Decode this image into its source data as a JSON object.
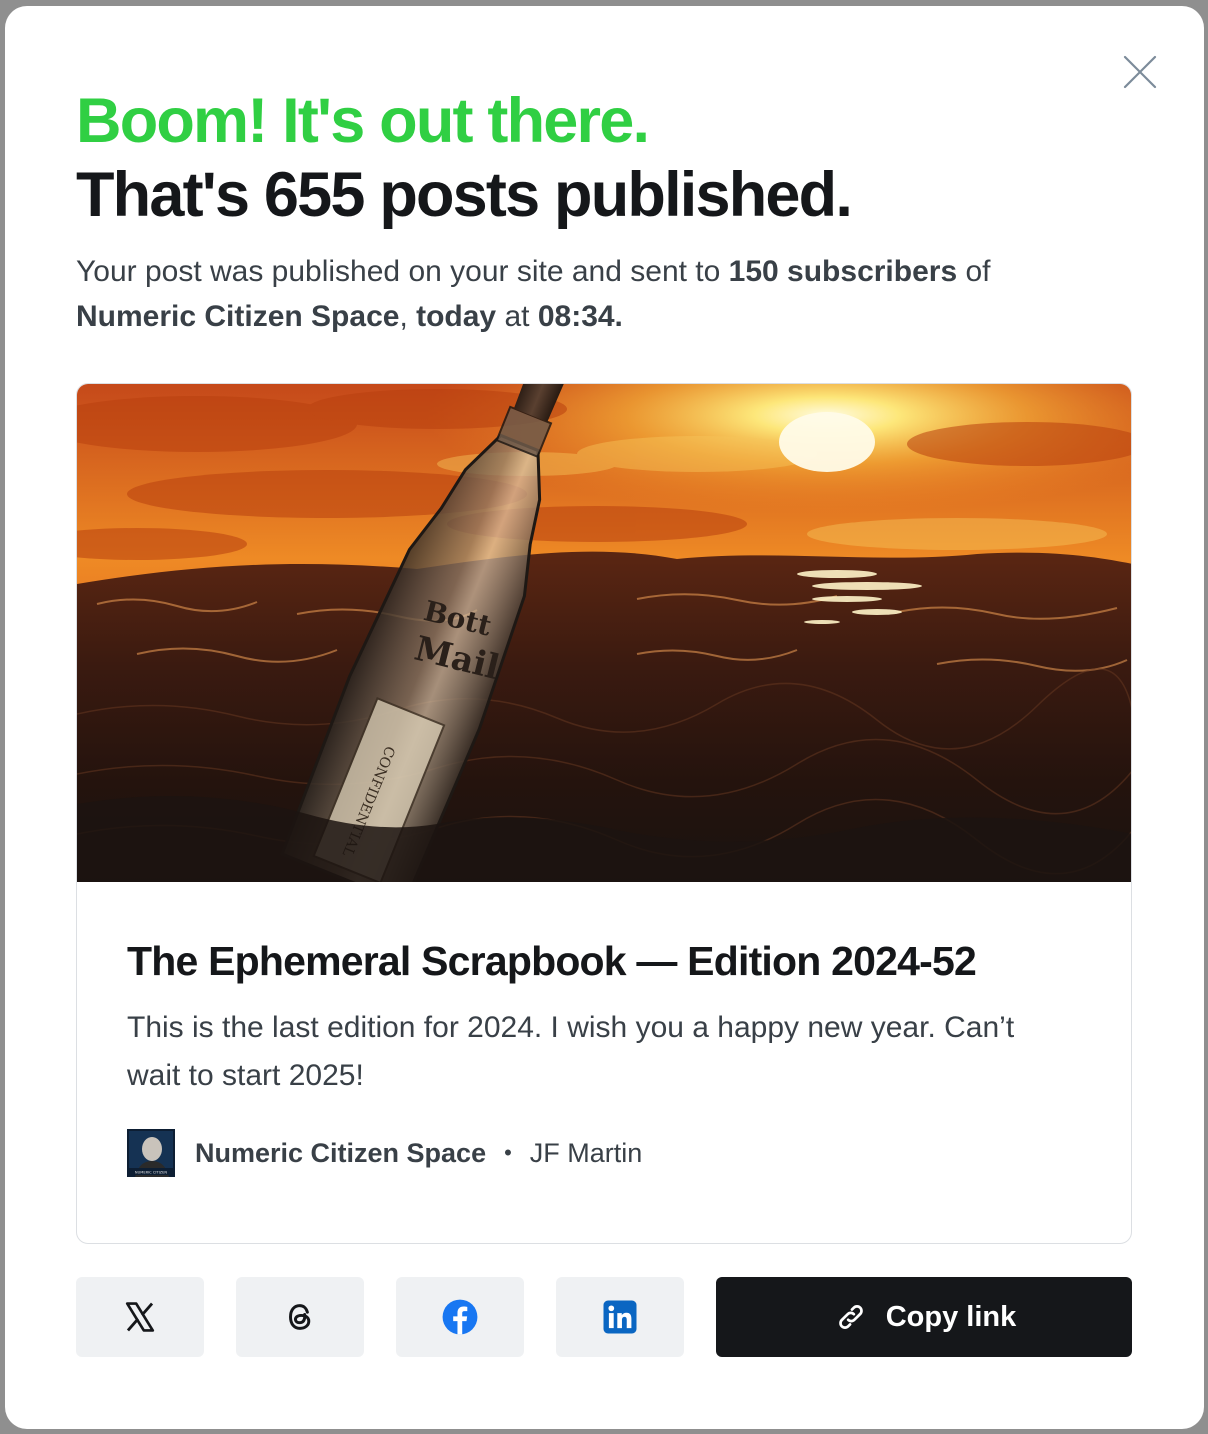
{
  "dialog": {
    "close_icon": "close-icon",
    "headline_success": "Boom! It's out there.",
    "headline_count": "That's 655 posts published.",
    "summary": {
      "prefix": "Your post was published on your site and sent to ",
      "subscribers": "150 subscribers",
      "of": " of",
      "site": "Numeric Citizen Space",
      "comma": ", ",
      "day": "today",
      "at": " at ",
      "time": "08:34."
    }
  },
  "post_card": {
    "image_description_icon": "message-in-bottle-at-sunset-image",
    "bottle_text_1": "Bott",
    "bottle_text_2": "Mail",
    "paper_text": "CONFIDENTIAL",
    "title": "The Ephemeral Scrapbook — Edition 2024-52",
    "excerpt": "This is the last edition for 2024. I wish you a happy new year. Can’t wait to start 2025!",
    "site_name": "Numeric Citizen Space",
    "separator": "•",
    "author": "JF Martin",
    "avatar_caption": "NUMERIC CITIZEN"
  },
  "share": {
    "buttons": [
      {
        "name": "x",
        "icon": "x-icon"
      },
      {
        "name": "threads",
        "icon": "threads-icon"
      },
      {
        "name": "facebook",
        "icon": "facebook-icon",
        "color": "#1877f2"
      },
      {
        "name": "linkedin",
        "icon": "linkedin-icon",
        "color": "#0a66c2"
      }
    ],
    "copy_link_label": "Copy link",
    "copy_link_icon": "link-icon"
  },
  "colors": {
    "accent_green": "#30cf43",
    "text_dark": "#15171a",
    "text_body": "#394047",
    "button_bg": "#eff1f3"
  }
}
